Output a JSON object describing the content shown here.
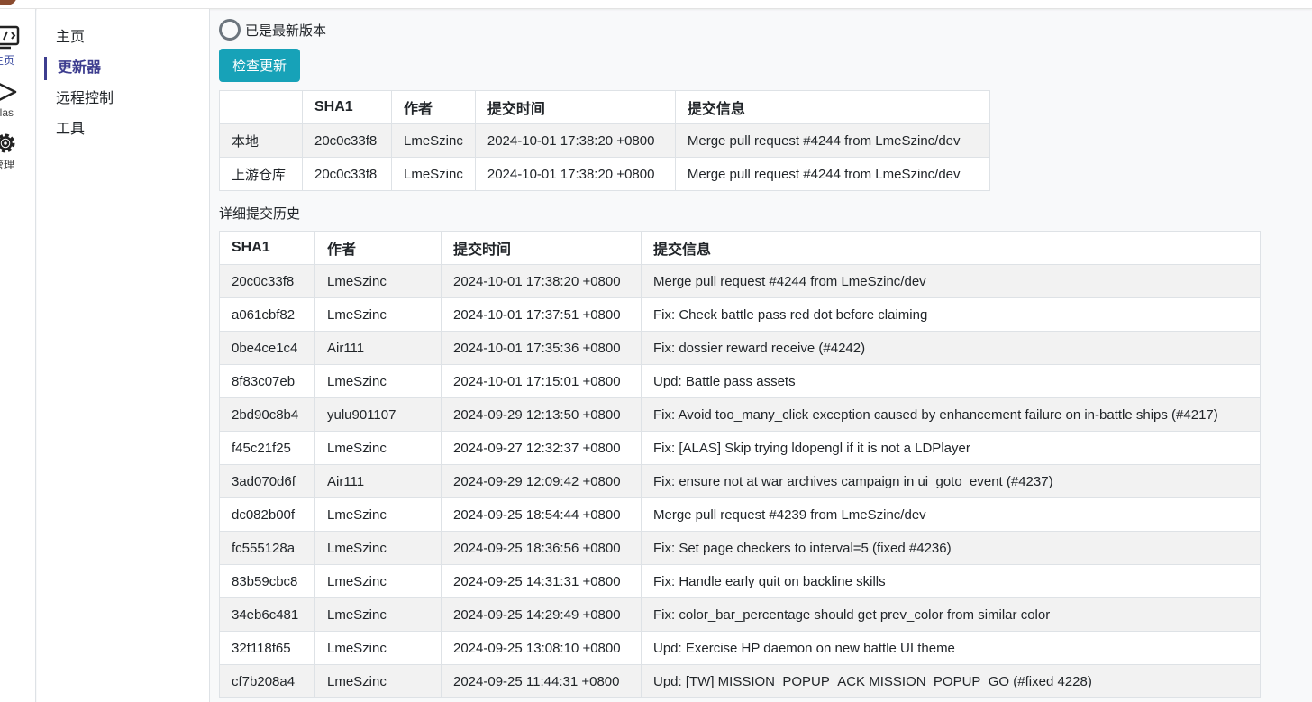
{
  "rail": [
    {
      "label": "主页",
      "icon": "code-monitor-icon",
      "active": true
    },
    {
      "label": "alas",
      "icon": "play-icon",
      "active": false
    },
    {
      "label": "管理",
      "icon": "gear-icon",
      "active": false
    }
  ],
  "menu": [
    {
      "label": "主页",
      "active": false
    },
    {
      "label": "更新器",
      "active": true
    },
    {
      "label": "远程控制",
      "active": false
    },
    {
      "label": "工具",
      "active": false
    }
  ],
  "status": {
    "text": "已是最新版本"
  },
  "check_button": {
    "label": "检查更新"
  },
  "compare_table": {
    "headers": [
      "",
      "SHA1",
      "作者",
      "提交时间",
      "提交信息"
    ],
    "rows": [
      [
        "本地",
        "20c0c33f8",
        "LmeSzinc",
        "2024-10-01 17:38:20 +0800",
        "Merge pull request #4244 from LmeSzinc/dev"
      ],
      [
        "上游仓库",
        "20c0c33f8",
        "LmeSzinc",
        "2024-10-01 17:38:20 +0800",
        "Merge pull request #4244 from LmeSzinc/dev"
      ]
    ]
  },
  "history": {
    "label": "详细提交历史",
    "headers": [
      "SHA1",
      "作者",
      "提交时间",
      "提交信息"
    ],
    "rows": [
      [
        "20c0c33f8",
        "LmeSzinc",
        "2024-10-01 17:38:20 +0800",
        "Merge pull request #4244 from LmeSzinc/dev"
      ],
      [
        "a061cbf82",
        "LmeSzinc",
        "2024-10-01 17:37:51 +0800",
        "Fix: Check battle pass red dot before claiming"
      ],
      [
        "0be4ce1c4",
        "Air111",
        "2024-10-01 17:35:36 +0800",
        "Fix: dossier reward receive (#4242)"
      ],
      [
        "8f83c07eb",
        "LmeSzinc",
        "2024-10-01 17:15:01 +0800",
        "Upd: Battle pass assets"
      ],
      [
        "2bd90c8b4",
        "yulu901107",
        "2024-09-29 12:13:50 +0800",
        "Fix: Avoid too_many_click exception caused by enhancement failure on in-battle ships (#4217)"
      ],
      [
        "f45c21f25",
        "LmeSzinc",
        "2024-09-27 12:32:37 +0800",
        "Fix: [ALAS] Skip trying ldopengl if it is not a LDPlayer"
      ],
      [
        "3ad070d6f",
        "Air111",
        "2024-09-29 12:09:42 +0800",
        "Fix: ensure not at war archives campaign in ui_goto_event (#4237)"
      ],
      [
        "dc082b00f",
        "LmeSzinc",
        "2024-09-25 18:54:44 +0800",
        "Merge pull request #4239 from LmeSzinc/dev"
      ],
      [
        "fc555128a",
        "LmeSzinc",
        "2024-09-25 18:36:56 +0800",
        "Fix: Set page checkers to interval=5 (fixed #4236)"
      ],
      [
        "83b59cbc8",
        "LmeSzinc",
        "2024-09-25 14:31:31 +0800",
        "Fix: Handle early quit on backline skills"
      ],
      [
        "34eb6c481",
        "LmeSzinc",
        "2024-09-25 14:29:49 +0800",
        "Fix: color_bar_percentage should get prev_color from similar color"
      ],
      [
        "32f118f65",
        "LmeSzinc",
        "2024-09-25 13:08:10 +0800",
        "Upd: Exercise HP daemon on new battle UI theme"
      ],
      [
        "cf7b208a4",
        "LmeSzinc",
        "2024-09-25 11:44:31 +0800",
        "Upd: [TW] MISSION_POPUP_ACK MISSION_POPUP_GO (#fixed 4228)"
      ]
    ]
  }
}
